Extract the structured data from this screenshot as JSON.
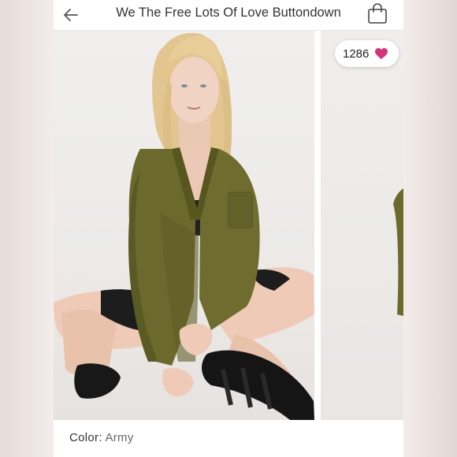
{
  "header": {
    "title": "We The Free Lots Of Love Buttondown"
  },
  "gallery": {
    "likes_count": "1286"
  },
  "product": {
    "color_label": "Color:",
    "color_value": "Army"
  },
  "colors": {
    "heart": "#d6337a",
    "shirt": "#6b6a2c",
    "background": "#ffffff"
  },
  "icons": {
    "back": "back-arrow-icon",
    "bag": "shopping-bag-icon",
    "like": "heart-icon"
  }
}
